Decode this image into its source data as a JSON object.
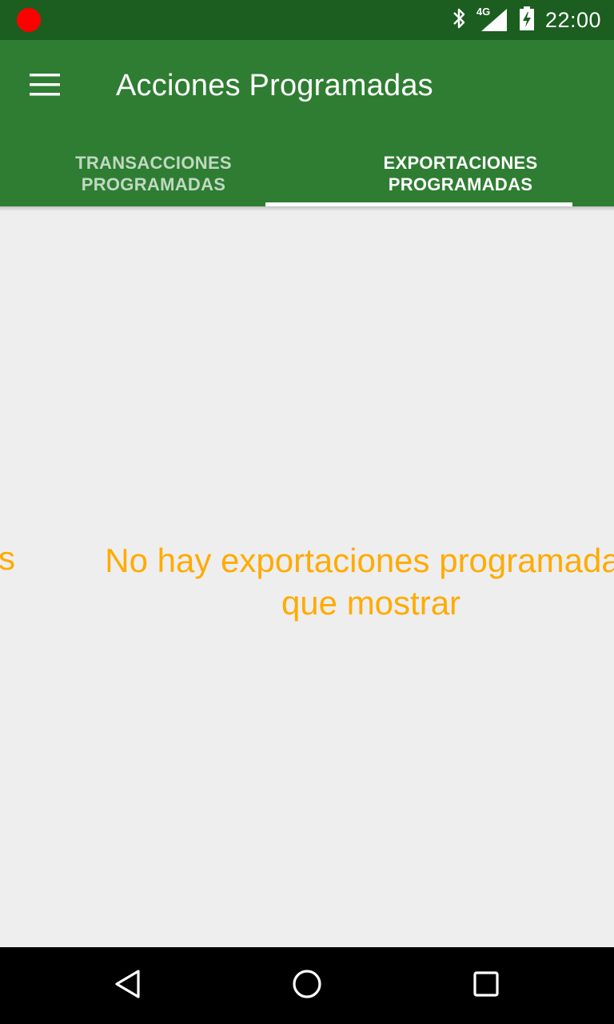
{
  "status_bar": {
    "time": "22:00",
    "network": "4G",
    "icons": [
      "record-indicator-icon",
      "bluetooth-icon",
      "signal-4g-icon",
      "battery-charging-icon"
    ]
  },
  "app_bar": {
    "title": "Acciones Programadas",
    "menu_icon": "hamburger-menu-icon"
  },
  "tabs": [
    {
      "label": "TRANSACCIONES\nPROGRAMADAS",
      "selected": false
    },
    {
      "label": "EXPORTACIONES\nPROGRAMADAS",
      "selected": true
    }
  ],
  "content": {
    "previous_page_peek": "s",
    "empty_message": "No hay exportaciones programadas que mostrar"
  },
  "nav_bar": {
    "icons": [
      "back-icon",
      "home-icon",
      "recents-icon"
    ]
  },
  "colors": {
    "status_bar": "#1b5e20",
    "app_bar": "#2e7d32",
    "accent_text": "#ffab00",
    "background": "#eeeeee"
  }
}
